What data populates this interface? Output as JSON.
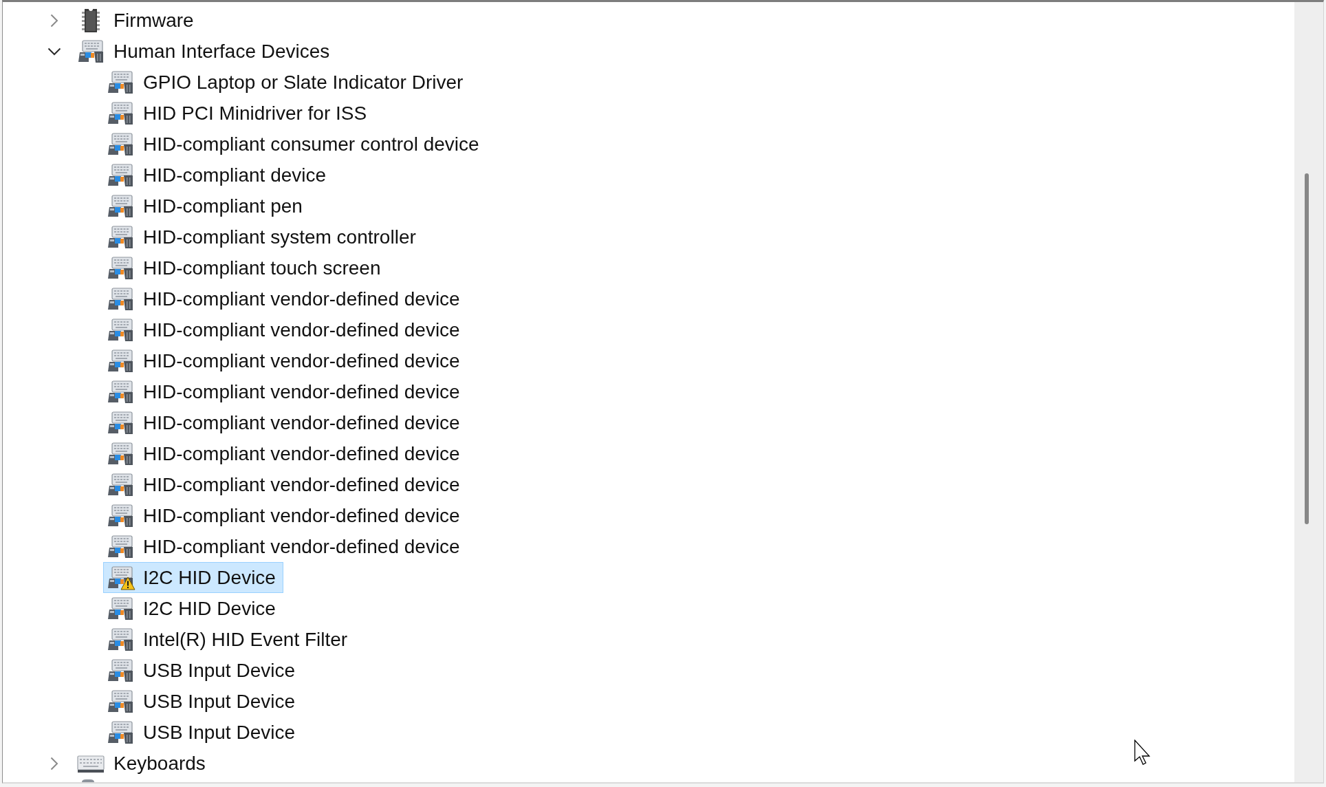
{
  "tree": [
    {
      "kind": "firmware",
      "label": "Firmware",
      "expanded": false,
      "selected": false
    },
    {
      "kind": "hid",
      "label": "Human Interface Devices",
      "expanded": true,
      "selected": false,
      "children": [
        {
          "label": "GPIO Laptop or Slate Indicator Driver",
          "selected": false,
          "warning": false
        },
        {
          "label": "HID PCI Minidriver for ISS",
          "selected": false,
          "warning": false
        },
        {
          "label": "HID-compliant consumer control device",
          "selected": false,
          "warning": false
        },
        {
          "label": "HID-compliant device",
          "selected": false,
          "warning": false
        },
        {
          "label": "HID-compliant pen",
          "selected": false,
          "warning": false
        },
        {
          "label": "HID-compliant system controller",
          "selected": false,
          "warning": false
        },
        {
          "label": "HID-compliant touch screen",
          "selected": false,
          "warning": false
        },
        {
          "label": "HID-compliant vendor-defined device",
          "selected": false,
          "warning": false
        },
        {
          "label": "HID-compliant vendor-defined device",
          "selected": false,
          "warning": false
        },
        {
          "label": "HID-compliant vendor-defined device",
          "selected": false,
          "warning": false
        },
        {
          "label": "HID-compliant vendor-defined device",
          "selected": false,
          "warning": false
        },
        {
          "label": "HID-compliant vendor-defined device",
          "selected": false,
          "warning": false
        },
        {
          "label": "HID-compliant vendor-defined device",
          "selected": false,
          "warning": false
        },
        {
          "label": "HID-compliant vendor-defined device",
          "selected": false,
          "warning": false
        },
        {
          "label": "HID-compliant vendor-defined device",
          "selected": false,
          "warning": false
        },
        {
          "label": "HID-compliant vendor-defined device",
          "selected": false,
          "warning": false
        },
        {
          "label": "I2C HID Device",
          "selected": true,
          "warning": true
        },
        {
          "label": "I2C HID Device",
          "selected": false,
          "warning": false
        },
        {
          "label": "Intel(R) HID Event Filter",
          "selected": false,
          "warning": false
        },
        {
          "label": "USB Input Device",
          "selected": false,
          "warning": false
        },
        {
          "label": "USB Input Device",
          "selected": false,
          "warning": false
        },
        {
          "label": "USB Input Device",
          "selected": false,
          "warning": false
        }
      ]
    },
    {
      "kind": "keyboard",
      "label": "Keyboards",
      "expanded": false,
      "selected": false
    }
  ]
}
